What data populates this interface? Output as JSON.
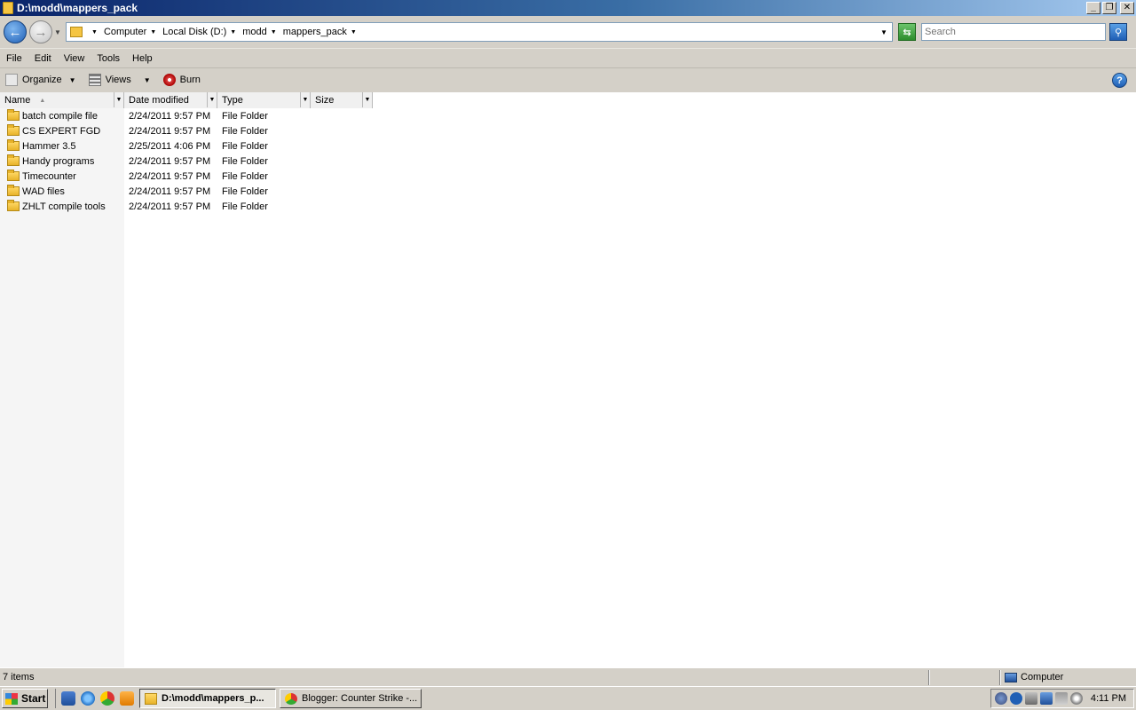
{
  "window": {
    "title": "D:\\modd\\mappers_pack",
    "minimize": "_",
    "restore": "❐",
    "close": "✕"
  },
  "address": {
    "crumbs": [
      "Computer",
      "Local Disk (D:)",
      "modd",
      "mappers_pack"
    ],
    "search_placeholder": "Search"
  },
  "menu": [
    "File",
    "Edit",
    "View",
    "Tools",
    "Help"
  ],
  "toolbar": {
    "organize": "Organize",
    "views": "Views",
    "burn": "Burn",
    "help": "?"
  },
  "columns": {
    "name": "Name",
    "date": "Date modified",
    "type": "Type",
    "size": "Size"
  },
  "rows": [
    {
      "name": "batch compile file",
      "date": "2/24/2011 9:57 PM",
      "type": "File Folder"
    },
    {
      "name": "CS EXPERT FGD",
      "date": "2/24/2011 9:57 PM",
      "type": "File Folder"
    },
    {
      "name": "Hammer 3.5",
      "date": "2/25/2011 4:06 PM",
      "type": "File Folder"
    },
    {
      "name": "Handy programs",
      "date": "2/24/2011 9:57 PM",
      "type": "File Folder"
    },
    {
      "name": "Timecounter",
      "date": "2/24/2011 9:57 PM",
      "type": "File Folder"
    },
    {
      "name": "WAD files",
      "date": "2/24/2011 9:57 PM",
      "type": "File Folder"
    },
    {
      "name": "ZHLT compile tools",
      "date": "2/24/2011 9:57 PM",
      "type": "File Folder"
    }
  ],
  "status": {
    "items": "7 items",
    "location": "Computer"
  },
  "taskbar": {
    "start": "Start",
    "tasks": [
      "D:\\modd\\mappers_p...",
      "Blogger: Counter Strike -..."
    ],
    "clock": "4:11 PM"
  },
  "icons": {
    "folder": "folder-icon",
    "back": "back-arrow-icon",
    "forward": "forward-arrow-icon",
    "search": "magnifier-icon"
  },
  "colors": {
    "titlebar_start": "#0a246a",
    "titlebar_end": "#a6caf0",
    "chrome": "#d4d0c8",
    "folder": "#f5c542"
  }
}
